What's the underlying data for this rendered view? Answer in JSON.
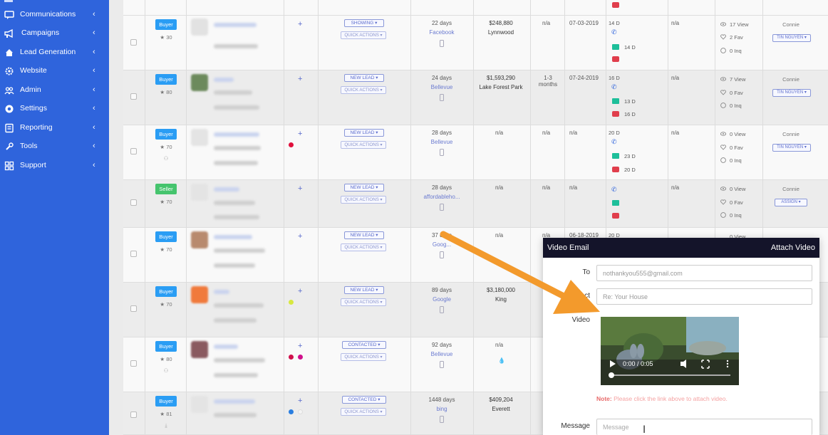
{
  "sidebar": {
    "items": [
      {
        "label": "Communications",
        "icon": "chat-icon"
      },
      {
        "label": "Campaigns",
        "icon": "megaphone-icon"
      },
      {
        "label": "Lead Generation",
        "icon": "home-icon"
      },
      {
        "label": "Website",
        "icon": "gear-icon"
      },
      {
        "label": "Admin",
        "icon": "users-icon"
      },
      {
        "label": "Settings",
        "icon": "settings-icon"
      },
      {
        "label": "Reporting",
        "icon": "report-icon"
      },
      {
        "label": "Tools",
        "icon": "wrench-icon"
      },
      {
        "label": "Support",
        "icon": "grid-icon"
      }
    ],
    "chevron": "‹"
  },
  "rows": [
    {
      "tag": "Buyer",
      "score": "★ 30",
      "status": "SHOWING ▾",
      "qa": "QUICK ACTIONS ▾",
      "days": "22 days",
      "source": "Facebook",
      "price": "$248,880",
      "city": "Lynnwood",
      "c1": "n/a",
      "date": "07-03-2019",
      "d1": "14 D",
      "d2": "14 D",
      "c2": "n/a",
      "views": "17 View",
      "favs": "2 Fav",
      "inq": "0 Inq",
      "agent": "Connie",
      "assign": "TIN NGUYEN ▾"
    },
    {
      "tag": "Buyer",
      "score": "★ 80",
      "status": "NEW LEAD ▾",
      "qa": "QUICK ACTIONS ▾",
      "days": "24 days",
      "source": "Bellevue",
      "price": "$1,593,290",
      "city": "Lake Forest Park",
      "c1": "1-3 months",
      "date": "07-24-2019",
      "d1": "16 D",
      "d2": "13 D",
      "d3": "16 D",
      "c2": "n/a",
      "views": "7 View",
      "favs": "0 Fav",
      "inq": "0 Inq",
      "agent": "Connie",
      "assign": "TIN NGUYEN ▾"
    },
    {
      "tag": "Buyer",
      "score": "★ 70",
      "status": "NEW LEAD ▾",
      "qa": "QUICK ACTIONS ▾",
      "days": "28 days",
      "source": "Bellevue",
      "price": "n/a",
      "city": "",
      "c1": "n/a",
      "date": "n/a",
      "d1": "20 D",
      "d2": "23 D",
      "d3": "20 D",
      "c2": "n/a",
      "views": "0 View",
      "favs": "0 Fav",
      "inq": "0 Inq",
      "agent": "Connie",
      "assign": "TIN NGUYEN ▾"
    },
    {
      "tag": "Seller",
      "score": "★ 70",
      "status": "NEW LEAD ▾",
      "qa": "QUICK ACTIONS ▾",
      "days": "28 days",
      "source": "affordableho...",
      "price": "n/a",
      "city": "",
      "c1": "n/a",
      "date": "n/a",
      "c2": "n/a",
      "views": "0 View",
      "favs": "0 Fav",
      "inq": "0 Inq",
      "agent": "Connie",
      "assign": "ASSIGN ▾"
    },
    {
      "tag": "Buyer",
      "score": "★ 70",
      "status": "NEW LEAD ▾",
      "qa": "QUICK ACTIONS ▾",
      "days": "37 days",
      "source": "Goog...",
      "price": "n/a",
      "city": "",
      "c1": "n/a",
      "date": "06-18-2019",
      "d1": "20 D",
      "views": "0 View"
    },
    {
      "tag": "Buyer",
      "score": "★ 70",
      "status": "NEW LEAD ▾",
      "qa": "QUICK ACTIONS ▾",
      "days": "89 days",
      "source": "Google",
      "price": "$3,180,000",
      "city": "King"
    },
    {
      "tag": "Buyer",
      "score": "★ 80",
      "status": "CONTACTED ▾",
      "qa": "QUICK ACTIONS ▾",
      "days": "92 days",
      "source": "Bellevue",
      "price": "n/a",
      "city": ""
    },
    {
      "tag": "Buyer",
      "score": "★ 81",
      "status": "CONTACTED ▾",
      "qa": "QUICK ACTIONS ▾",
      "days": "1448 days",
      "source": "bing",
      "price": "$409,204",
      "city": "Everett"
    }
  ],
  "modal": {
    "title": "Video Email",
    "attach": "Attach Video",
    "to_label": "To",
    "to_value": "nothankyou555@gmail.com",
    "subject_label": "Subject",
    "subject_value": "Re: Your House",
    "video_label": "Video",
    "video_time": "0:00 / 0:05",
    "note_bold": "Note:",
    "note_text": "Please click the link above to attach video.",
    "message_label": "Message",
    "message_placeholder": "Message"
  },
  "colors": {
    "sidebar": "#2f64dc",
    "modal_header": "#14142a",
    "arrow": "#f39a2c",
    "buyer": "#2a9df4",
    "seller": "#45c46d"
  }
}
